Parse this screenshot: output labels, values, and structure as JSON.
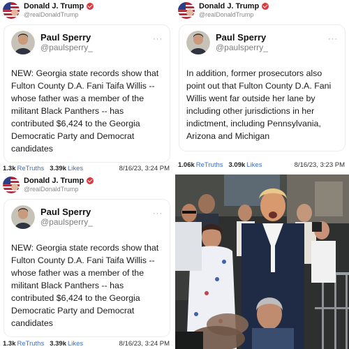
{
  "posts": [
    {
      "author_name": "Donald J. Trump",
      "author_handle": "@realDonaldTrump",
      "quoted_name": "Paul Sperry",
      "quoted_handle": "@paulsperry_",
      "quoted_text": "NEW: Georgia state records show that Fulton County D.A. Fani Taifa Willis -- whose father was a member of the militant Black Panthers -- has contributed $6,424 to the Georgia Democratic Party and Democrat candidates",
      "retruths": "1.3k",
      "retruths_label": "ReTruths",
      "likes": "3.39k",
      "likes_label": "Likes",
      "date": "8/16/23, 3:24 PM"
    },
    {
      "author_name": "Donald J. Trump",
      "author_handle": "@realDonaldTrump",
      "quoted_name": "Paul Sperry",
      "quoted_handle": "@paulsperry_",
      "quoted_text": "In addition, former prosecutors also point out that Fulton County D.A. Fani Willis went far outside her lane by including other jurisdictions in her indictment, including Pennsylvania, Arizona and Michigan",
      "retruths": "1.06k",
      "retruths_label": "ReTruths",
      "likes": "3.09k",
      "likes_label": "Likes",
      "date": "8/16/23, 3:23 PM"
    },
    {
      "author_name": "Donald J. Trump",
      "author_handle": "@realDonaldTrump",
      "quoted_name": "Paul Sperry",
      "quoted_handle": "@paulsperry_",
      "quoted_text": "NEW: Georgia state records show that Fulton County D.A. Fani Taifa Willis -- whose father was a member of the militant Black Panthers -- has contributed $6,424 to the Georgia Democratic Party and Democrat candidates",
      "retruths": "1.3k",
      "retruths_label": "ReTruths",
      "likes": "3.39k",
      "likes_label": "Likes",
      "date": "8/16/23, 3:24 PM"
    }
  ],
  "more_label": "···",
  "photo": {
    "subject": "crowd-photo"
  }
}
